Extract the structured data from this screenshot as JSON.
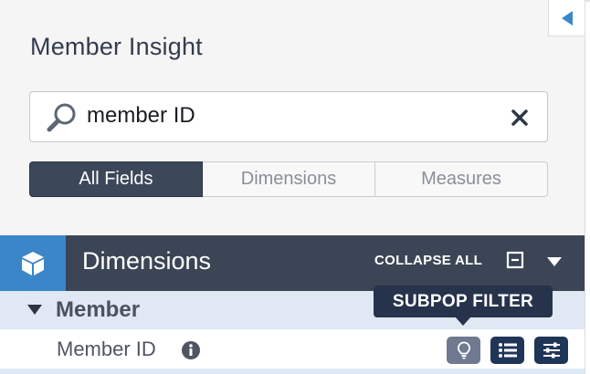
{
  "panel": {
    "title": "Member Insight"
  },
  "search": {
    "value": "member ID"
  },
  "filter_tabs": [
    {
      "label": "All Fields",
      "active": true
    },
    {
      "label": "Dimensions",
      "active": false
    },
    {
      "label": "Measures",
      "active": false
    }
  ],
  "dimensions_header": {
    "title": "Dimensions",
    "collapse_all_label": "COLLAPSE ALL"
  },
  "groups": [
    {
      "label": "Member",
      "fields": [
        {
          "label": "Member ID"
        }
      ]
    }
  ],
  "tooltip": {
    "text": "SUBPOP FILTER"
  },
  "icons": {
    "collapse_tab": "left-triangle-icon",
    "search": "search-icon",
    "clear": "close-icon",
    "cube": "cube-icon",
    "collapse_all": "minus-square-icon",
    "dropdown": "caret-down-icon",
    "group_toggle": "triangle-down-icon",
    "info": "info-icon",
    "subpop_filter": "lightbulb-icon",
    "list": "list-icon",
    "filter": "sliders-icon"
  },
  "colors": {
    "accent_blue": "#3a86c8",
    "header_dark": "#3b4555",
    "active_tab": "#3c475a",
    "group_row": "#dfe8f3",
    "tooltip": "#26334b",
    "action_dark": "#1f3557",
    "action_muted": "#6f7a90"
  }
}
